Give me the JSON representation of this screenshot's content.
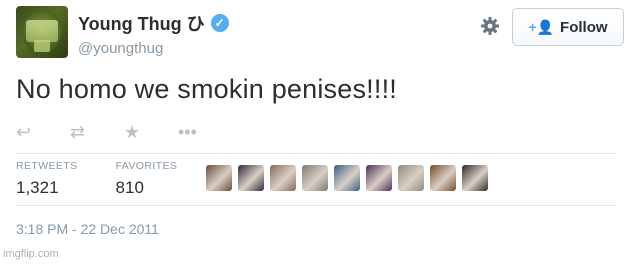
{
  "user": {
    "display_name": "Young Thug ひ",
    "handle": "@youngthug",
    "verified_icon": "✓"
  },
  "header": {
    "follow_label": "Follow",
    "follow_icon": "+👤"
  },
  "tweet": {
    "text": "No homo we smokin penises!!!!"
  },
  "actions": [
    {
      "name": "reply-icon",
      "glyph": "↩"
    },
    {
      "name": "retweet-icon",
      "glyph": "⇄"
    },
    {
      "name": "favorite-icon",
      "glyph": "★"
    },
    {
      "name": "more-icon",
      "glyph": "•••"
    }
  ],
  "stats": {
    "retweets_label": "RETWEETS",
    "retweets_value": "1,321",
    "favorites_label": "FAVORITES",
    "favorites_value": "810"
  },
  "favoriter_avatars": [
    "#6b4a3a",
    "#2f2a3a",
    "#8a6a55",
    "#7a7a72",
    "#3a5f8a",
    "#4a2f5a",
    "#8c8c80",
    "#7a4a28",
    "#2a2a2a"
  ],
  "timestamp": "3:18 PM - 22 Dec 2011",
  "watermark": "imgflip.com",
  "colors": {
    "accent": "#55acee",
    "muted": "#8899a6",
    "text": "#292f33"
  }
}
